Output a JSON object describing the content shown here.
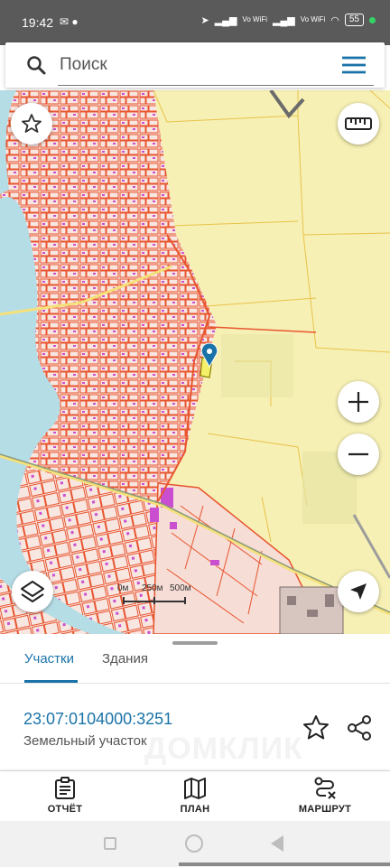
{
  "status_bar": {
    "time": "19:42",
    "network_labels": [
      "Vo WiFi",
      "Vo WiFi"
    ],
    "battery": "55"
  },
  "search": {
    "placeholder": "Поиск"
  },
  "icons": {
    "search": "search-icon",
    "menu": "hamburger-menu-icon",
    "favorite": "star-icon",
    "ruler": "ruler-icon",
    "zoom_in": "plus-icon",
    "zoom_out": "minus-icon",
    "layers": "layers-icon",
    "locate": "navigation-arrow-icon",
    "marker": "map-pin-icon",
    "share": "share-icon",
    "report": "clipboard-icon",
    "plan": "map-icon",
    "route": "route-icon"
  },
  "map": {
    "scale_labels": [
      "0м",
      "250м",
      "500м"
    ]
  },
  "sheet": {
    "tabs": [
      {
        "label": "Участки",
        "active": true
      },
      {
        "label": "Здания",
        "active": false
      }
    ],
    "parcel": {
      "cadastral_number": "23:07:0104000:3251",
      "type": "Земельный участок"
    },
    "watermark": "ДОМКЛИК"
  },
  "actions": [
    {
      "label": "ОТЧЁТ"
    },
    {
      "label": "ПЛАН"
    },
    {
      "label": "МАРШРУТ"
    }
  ],
  "colors": {
    "accent": "#1a73a8",
    "parcel_outline": "#e8552f",
    "farmland": "#f7f0b4",
    "river": "#b5dde6"
  }
}
